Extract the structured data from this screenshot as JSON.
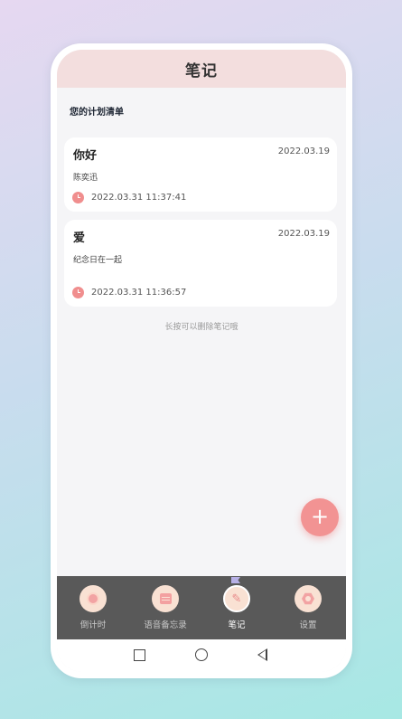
{
  "header": {
    "title": "笔记"
  },
  "section": {
    "title": "您的计划清单"
  },
  "notes": [
    {
      "title": "你好",
      "date": "2022.03.19",
      "body": "陈奕迅",
      "time": "2022.03.31 11:37:41"
    },
    {
      "title": "爱",
      "date": "2022.03.19",
      "body": "纪念日在一起",
      "time": "2022.03.31 11:36:57"
    }
  ],
  "hint": "长按可以删除笔记哦",
  "fab": {
    "label": "+"
  },
  "tabs": [
    {
      "label": "倒计时",
      "icon": "timer-icon"
    },
    {
      "label": "语音备忘录",
      "icon": "calendar-icon"
    },
    {
      "label": "笔记",
      "icon": "pen-icon",
      "active": true
    },
    {
      "label": "设置",
      "icon": "gear-icon"
    }
  ],
  "colors": {
    "accent": "#f29393",
    "header_bg": "#f3dede",
    "tabbar_bg": "#595959"
  }
}
